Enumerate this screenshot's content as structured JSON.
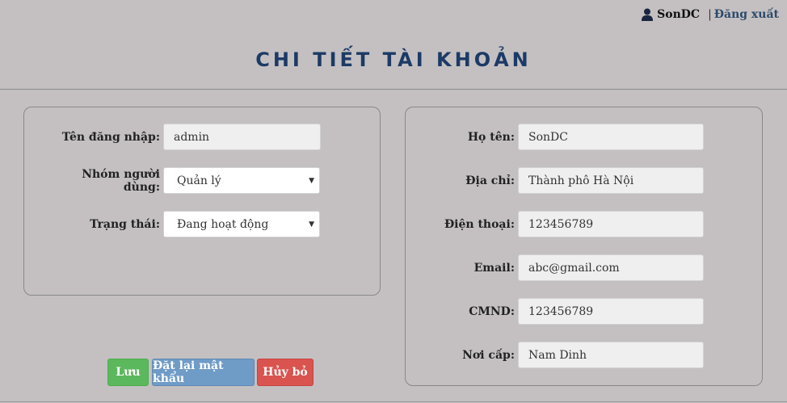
{
  "header": {
    "username": "SonDC",
    "separator": "|",
    "logout_label": "Đăng xuất"
  },
  "page": {
    "title": "CHI TIẾT TÀI KHOẢN"
  },
  "account": {
    "username_label": "Tên đăng nhập:",
    "username_value": "admin",
    "group_label": "Nhóm người dùng:",
    "group_value": "Quản lý",
    "status_label": "Trạng thái:",
    "status_value": "Đang hoạt động"
  },
  "profile": {
    "fullname_label": "Họ tên:",
    "fullname_value": "SonDC",
    "address_label": "Địa chỉ:",
    "address_value": "Thành phô Hà Nội",
    "phone_label": "Điện thoại:",
    "phone_value": "123456789",
    "email_label": "Email:",
    "email_value": "abc@gmail.com",
    "id_label": "CMND:",
    "id_value": "123456789",
    "issued_label": "Nơi cấp:",
    "issued_value": "Nam Dinh"
  },
  "actions": {
    "save_label": "Lưu",
    "reset_label": "Đặt lại mật khẩu",
    "cancel_label": "Hủy bỏ"
  },
  "colors": {
    "background": "#c4c0c2",
    "title": "#1c3a66",
    "save": "#5cb85c",
    "reset": "#6f9bc7",
    "cancel": "#d9534f"
  },
  "icons": {
    "user": "user-icon",
    "dropdown": "caret-down-icon"
  }
}
